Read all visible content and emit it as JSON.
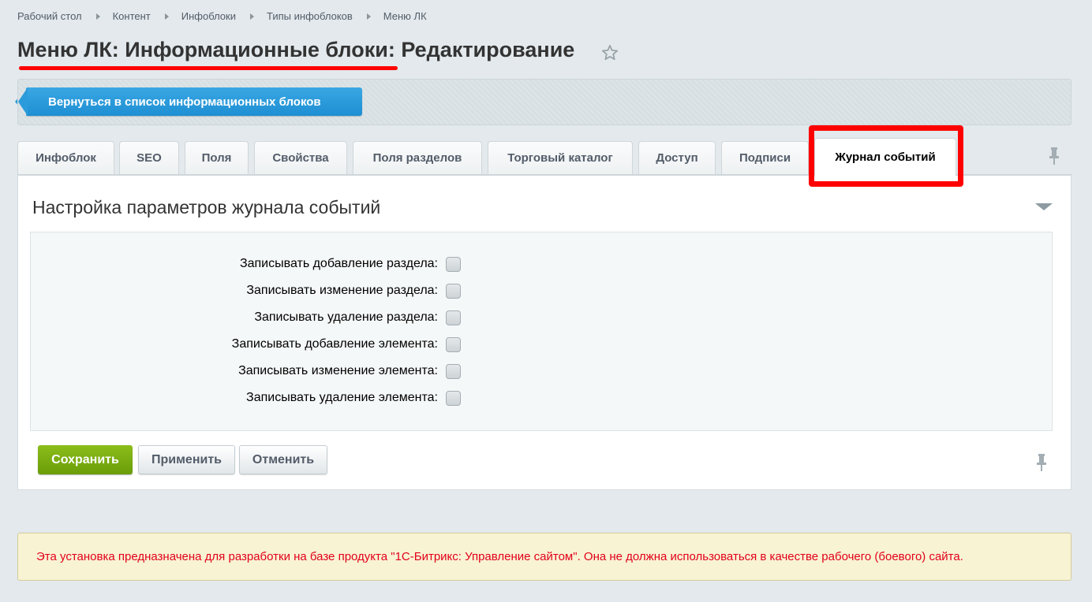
{
  "breadcrumb": [
    "Рабочий стол",
    "Контент",
    "Инфоблоки",
    "Типы инфоблоков",
    "Меню ЛК"
  ],
  "page_title": "Меню ЛК: Информационные блоки: Редактирование",
  "toolbar": {
    "back_label": "Вернуться в список информационных блоков"
  },
  "tabs": [
    {
      "label": "Инфоблок"
    },
    {
      "label": "SEO"
    },
    {
      "label": "Поля"
    },
    {
      "label": "Свойства"
    },
    {
      "label": "Поля разделов"
    },
    {
      "label": "Торговый каталог"
    },
    {
      "label": "Доступ"
    },
    {
      "label": "Подписи"
    },
    {
      "label": "Журнал событий",
      "active": true
    }
  ],
  "section": {
    "title": "Настройка параметров журнала событий",
    "fields": [
      {
        "label": "Записывать добавление раздела:",
        "checked": false
      },
      {
        "label": "Записывать изменение раздела:",
        "checked": false
      },
      {
        "label": "Записывать удаление раздела:",
        "checked": false
      },
      {
        "label": "Записывать добавление элемента:",
        "checked": false
      },
      {
        "label": "Записывать изменение элемента:",
        "checked": false
      },
      {
        "label": "Записывать удаление элемента:",
        "checked": false
      }
    ]
  },
  "buttons": {
    "save": "Сохранить",
    "apply": "Применить",
    "cancel": "Отменить"
  },
  "warning": "Эта установка предназначена для разработки на базе продукта \"1С-Битрикс: Управление сайтом\". Она не должна использоваться в качестве рабочего (боевого) сайта.",
  "colors": {
    "accent_blue": "#1e8fd3",
    "save_green": "#6a9d08",
    "highlight_red": "#ff0000",
    "warning_text": "#e2001a"
  },
  "icons": [
    "star-icon",
    "pin-icon",
    "collapse-arrow-icon",
    "back-arrow-icon"
  ]
}
